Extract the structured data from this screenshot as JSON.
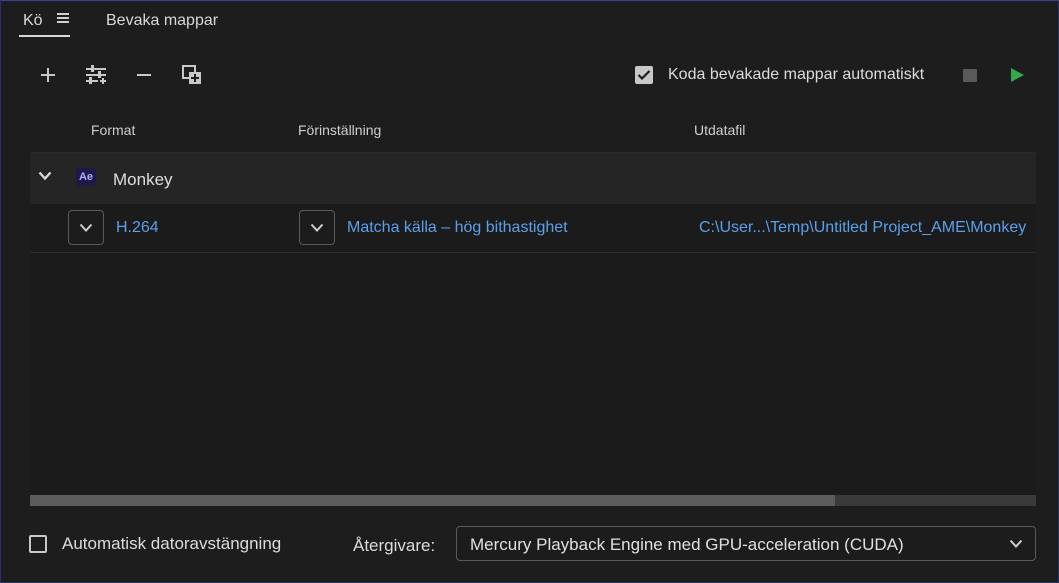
{
  "tabs": [
    {
      "label": "Kö"
    },
    {
      "label": "Bevaka mappar"
    }
  ],
  "toolbar": {
    "auto_encode_label": "Koda bevakade mappar automatiskt",
    "auto_encode_checked": true
  },
  "columns": {
    "format": "Format",
    "preset": "Förinställning",
    "output": "Utdatafil"
  },
  "queue": {
    "group": {
      "name": "Monkey",
      "app_badge": "Ae"
    },
    "items": [
      {
        "format": "H.264",
        "preset": "Matcha källa – hög bithastighet",
        "output": "C:\\User...\\Temp\\Untitled Project_AME\\Monkey"
      }
    ],
    "scroll_fraction": 0.8
  },
  "bottom": {
    "auto_shutdown_label": "Automatisk datoravstängning",
    "auto_shutdown_checked": false,
    "renderer_label": "Återgivare:",
    "renderer_value": "Mercury Playback Engine med GPU-acceleration (CUDA)"
  },
  "colors": {
    "accent_link": "#5aa0ea",
    "play_green": "#2fa84f",
    "ae_badge": "#1c1a4a"
  }
}
